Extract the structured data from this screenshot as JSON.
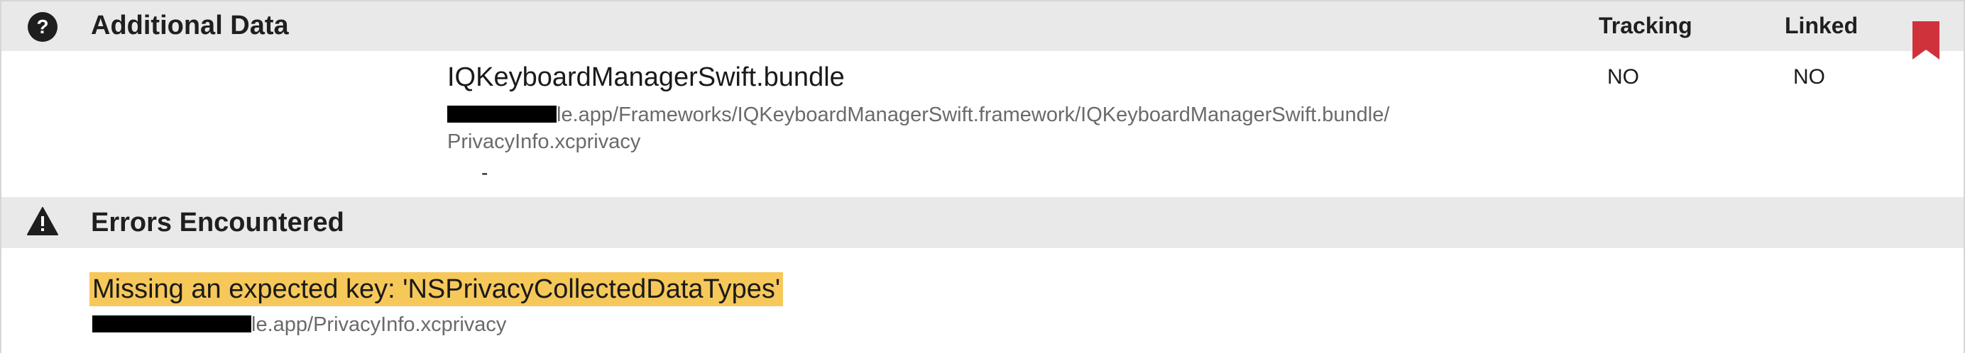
{
  "additional_data": {
    "title": "Additional Data",
    "help_icon": "?",
    "columns": {
      "tracking": "Tracking",
      "linked": "Linked"
    },
    "entry": {
      "name": "IQKeyboardManagerSwift.bundle",
      "path_line1_suffix": "le.app/Frameworks/IQKeyboardManagerSwift.framework/IQKeyboardManagerSwift.bundle/",
      "path_line2": "PrivacyInfo.xcprivacy",
      "detail": "-",
      "tracking": "NO",
      "linked": "NO"
    }
  },
  "errors": {
    "title": "Errors Encountered",
    "message": "Missing an expected key: 'NSPrivacyCollectedDataTypes'",
    "path_suffix": "le.app/PrivacyInfo.xcprivacy"
  },
  "colors": {
    "header_bg": "#e9e9e9",
    "highlight": "#f6c85a",
    "bookmark": "#d0323b"
  },
  "icons": {
    "help": "help-circle-icon",
    "warning": "warning-triangle-icon",
    "bookmark": "bookmark-icon"
  }
}
